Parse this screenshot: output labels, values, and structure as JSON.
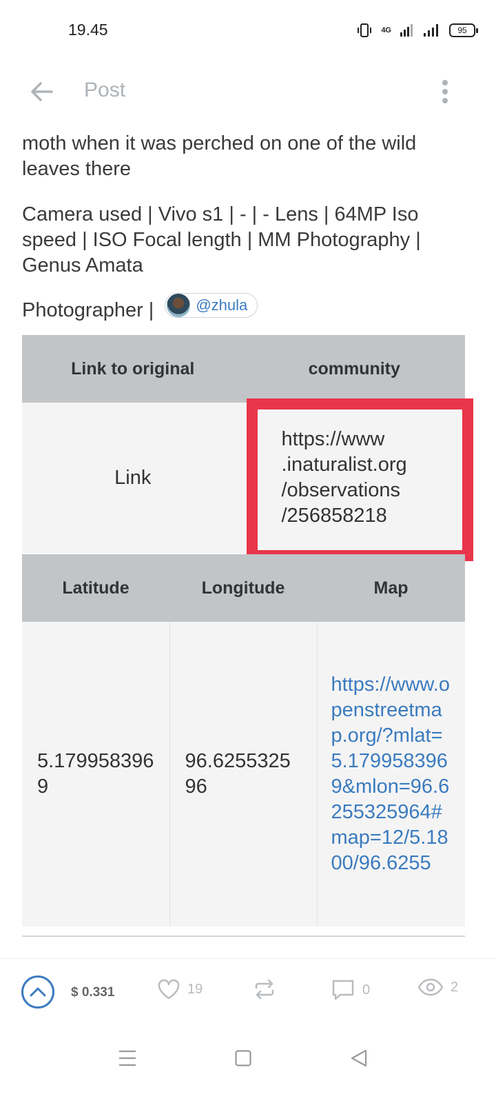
{
  "status_bar": {
    "time": "19.45",
    "network": "4G",
    "battery": "95"
  },
  "header": {
    "title": "Post"
  },
  "post": {
    "paragraph1": "moth when it was perched on one of the wild leaves there",
    "paragraph2": "Camera used | Vivo s1 | - | - Lens | 64MP Iso speed | ISO Focal length | MM Photography | Genus Amata",
    "photographer_label": "Photographer |",
    "mention": "@zhula"
  },
  "table_original": {
    "headers": [
      "Link to original",
      "community"
    ],
    "row": [
      "Link",
      "https://www.inaturalist.org/observations/256858218"
    ],
    "url_lines": [
      "https://www",
      ".inaturalist.org",
      "/observations",
      "/256858218"
    ]
  },
  "table_location": {
    "headers": [
      "Latitude",
      "Longitude",
      "Map"
    ],
    "latitude": "5.1799583969",
    "longitude": "96.625532596",
    "map_link": "https://www.openstreetmap.org/?mlat=5.1799583969&mlon=96.6255325964#map=12/5.1800/96.6255"
  },
  "actions": {
    "payout": "$ 0.331",
    "likes": "19",
    "comments": "0",
    "views": "2"
  },
  "colors": {
    "accent": "#3b7bbf",
    "highlight": "#e8354a",
    "table_header": "#c1c5c8",
    "table_cell": "#f4f4f4"
  }
}
